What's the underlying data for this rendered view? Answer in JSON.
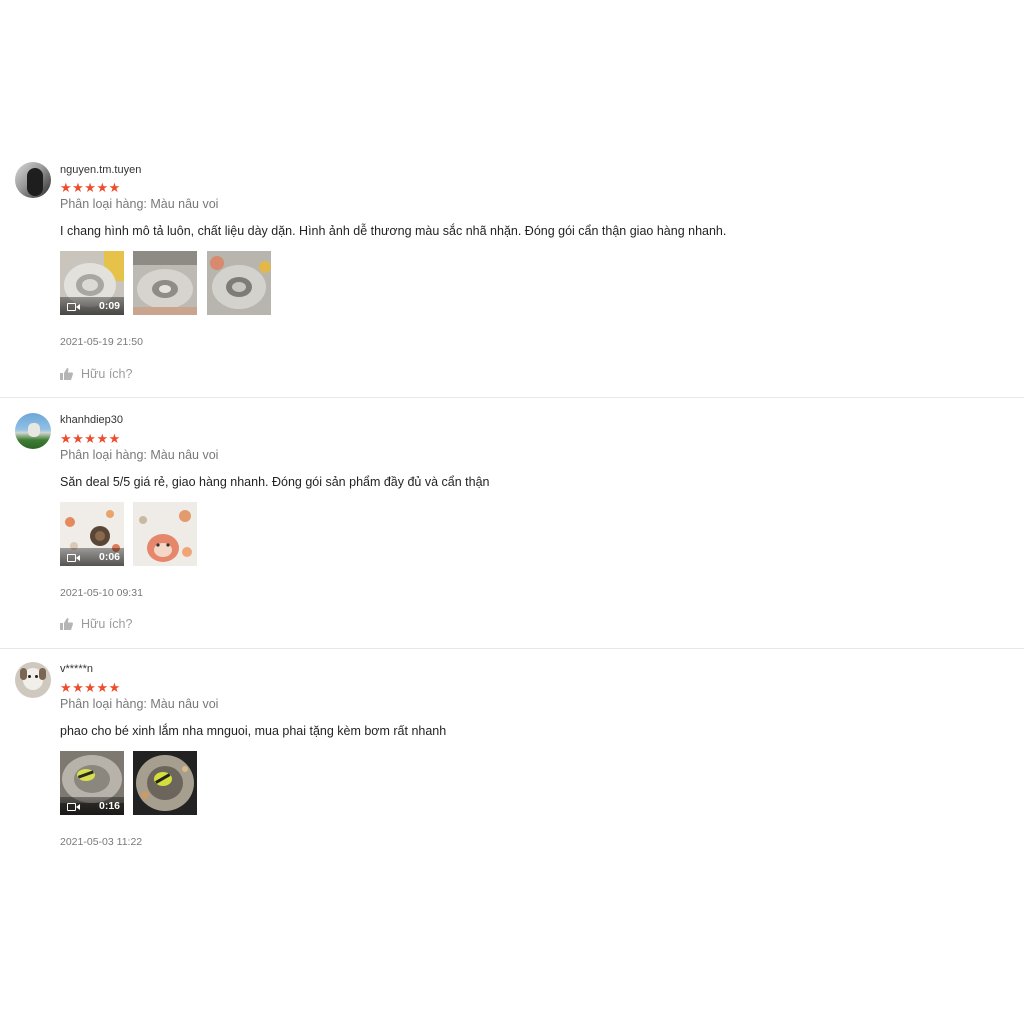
{
  "reviews": [
    {
      "username": "nguyen.tm.tuyen",
      "stars": "★★★★★",
      "rating": 5,
      "variation": "Phân loại hàng: Màu nâu voi",
      "comment": "I chang hình mô tả luôn, chất liệu dày dặn. Hình ảnh dễ thương màu sắc nhã nhặn. Đóng gói cẩn thận giao hàng nhanh.",
      "video_duration": "0:09",
      "timestamp": "2021-05-19 21:50",
      "helpful_label": "Hữu ích?"
    },
    {
      "username": "khanhdiep30",
      "stars": "★★★★★",
      "rating": 5,
      "variation": "Phân loại hàng: Màu nâu voi",
      "comment": "Săn deal 5/5 giá rẻ, giao hàng nhanh. Đóng gói sản phẩm đầy đủ và cẩn thận",
      "video_duration": "0:06",
      "timestamp": "2021-05-10 09:31",
      "helpful_label": "Hữu ích?"
    },
    {
      "username": "v*****n",
      "stars": "★★★★★",
      "rating": 5,
      "variation": "Phân loại hàng: Màu nâu voi",
      "comment": "phao cho bé xinh lắm nha mnguoi, mua phai tặng kèm bơm rất nhanh",
      "video_duration": "0:16",
      "timestamp": "2021-05-03 11:22"
    }
  ],
  "colors": {
    "star": "#ee4d2d",
    "muted_text": "#8a8a8a",
    "divider": "#e8e8e8"
  },
  "icons": {
    "helpful": "thumbs-up-icon",
    "video": "video-camera-icon",
    "more": "more-options-icon"
  }
}
